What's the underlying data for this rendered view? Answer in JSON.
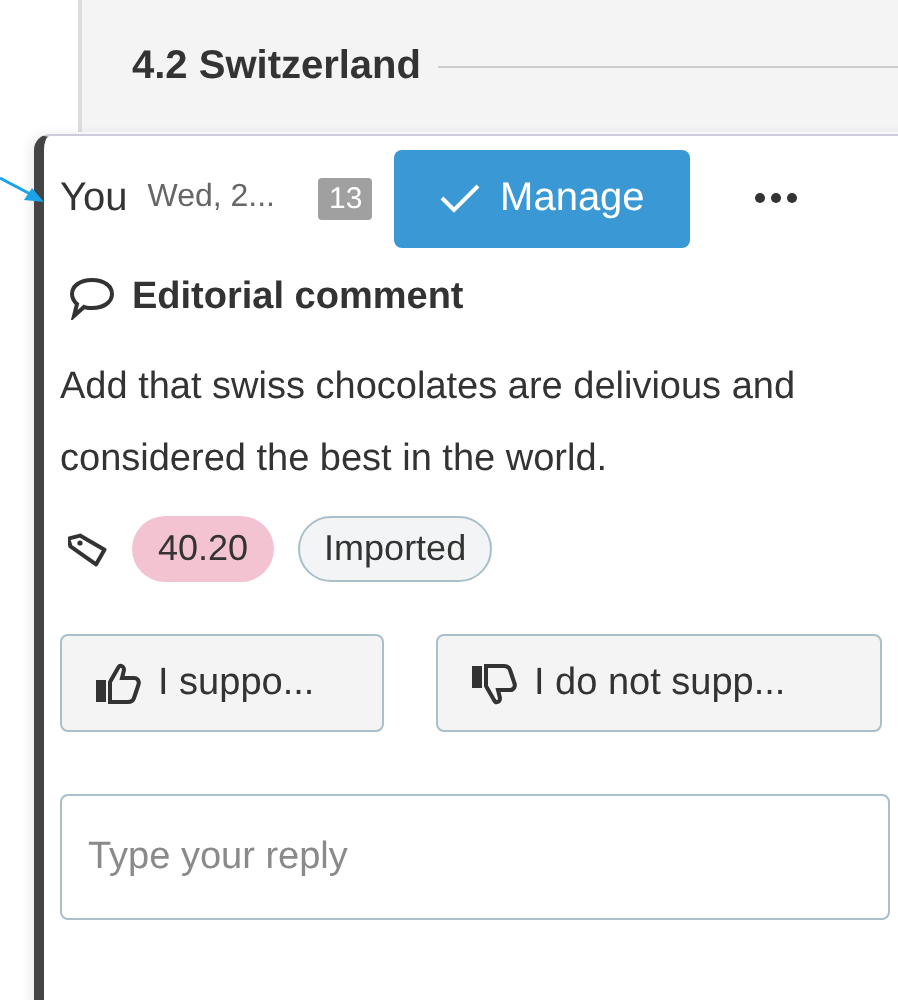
{
  "section": {
    "heading": "4.2 Switzerland"
  },
  "comment": {
    "author": "You",
    "date": "Wed, 2...",
    "count": "13",
    "manage_button": "Manage",
    "title": "Editorial comment",
    "body": "Add that swiss chocolates are delivious and considered the best in the world.",
    "tags": [
      {
        "label": "40.20",
        "color": "#f4c3d2"
      },
      {
        "label": "Imported",
        "color": "#f2f4f5"
      }
    ],
    "support_button": "I suppo...",
    "oppose_button": "I do not supp...",
    "reply": {
      "placeholder": "Type your reply"
    }
  }
}
